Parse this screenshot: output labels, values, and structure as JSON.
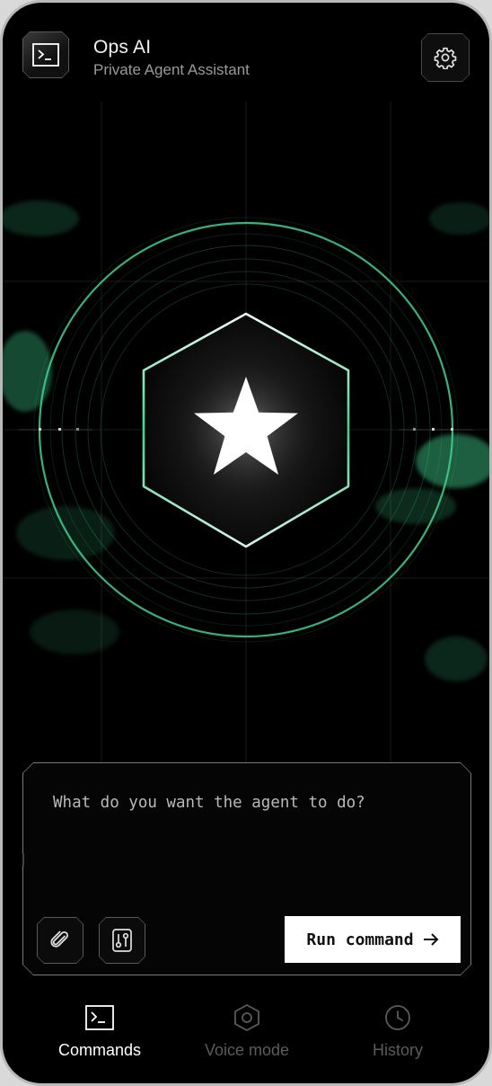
{
  "header": {
    "title": "Ops AI",
    "subtitle": "Private Agent Assistant",
    "logo_icon": "terminal-icon",
    "settings_icon": "gear-icon"
  },
  "hero": {
    "center_icon": "star-icon",
    "accent_color": "#3fd28f"
  },
  "command": {
    "placeholder": "What do you want the agent to do?",
    "value": "",
    "attach_icon": "paperclip-icon",
    "tools_icon": "sliders-icon",
    "run_label": "Run command",
    "run_icon": "arrow-right-icon"
  },
  "nav": {
    "items": [
      {
        "label": "Commands",
        "icon": "terminal-icon",
        "active": true
      },
      {
        "label": "Voice mode",
        "icon": "hexagon-icon",
        "active": false
      },
      {
        "label": "History",
        "icon": "clock-icon",
        "active": false
      }
    ]
  },
  "colors": {
    "background": "#000000",
    "accent": "#3fd28f",
    "run_button_bg": "#ffffff",
    "inactive_text": "#5b5b5b"
  }
}
